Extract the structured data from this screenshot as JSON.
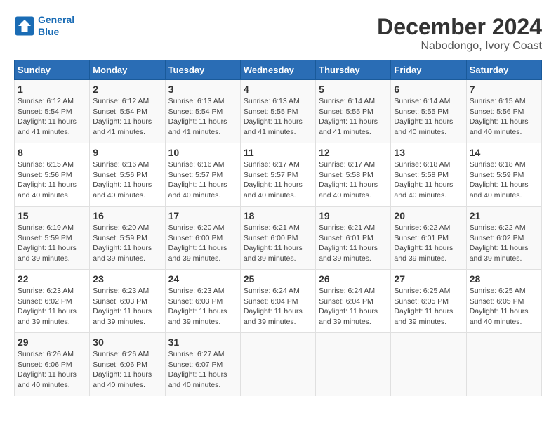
{
  "logo": {
    "line1": "General",
    "line2": "Blue"
  },
  "title": "December 2024",
  "subtitle": "Nabodongo, Ivory Coast",
  "days_of_week": [
    "Sunday",
    "Monday",
    "Tuesday",
    "Wednesday",
    "Thursday",
    "Friday",
    "Saturday"
  ],
  "weeks": [
    [
      {
        "num": "1",
        "sunrise": "6:12 AM",
        "sunset": "5:54 PM",
        "daylight": "11 hours and 41 minutes."
      },
      {
        "num": "2",
        "sunrise": "6:12 AM",
        "sunset": "5:54 PM",
        "daylight": "11 hours and 41 minutes."
      },
      {
        "num": "3",
        "sunrise": "6:13 AM",
        "sunset": "5:54 PM",
        "daylight": "11 hours and 41 minutes."
      },
      {
        "num": "4",
        "sunrise": "6:13 AM",
        "sunset": "5:55 PM",
        "daylight": "11 hours and 41 minutes."
      },
      {
        "num": "5",
        "sunrise": "6:14 AM",
        "sunset": "5:55 PM",
        "daylight": "11 hours and 41 minutes."
      },
      {
        "num": "6",
        "sunrise": "6:14 AM",
        "sunset": "5:55 PM",
        "daylight": "11 hours and 40 minutes."
      },
      {
        "num": "7",
        "sunrise": "6:15 AM",
        "sunset": "5:56 PM",
        "daylight": "11 hours and 40 minutes."
      }
    ],
    [
      {
        "num": "8",
        "sunrise": "6:15 AM",
        "sunset": "5:56 PM",
        "daylight": "11 hours and 40 minutes."
      },
      {
        "num": "9",
        "sunrise": "6:16 AM",
        "sunset": "5:56 PM",
        "daylight": "11 hours and 40 minutes."
      },
      {
        "num": "10",
        "sunrise": "6:16 AM",
        "sunset": "5:57 PM",
        "daylight": "11 hours and 40 minutes."
      },
      {
        "num": "11",
        "sunrise": "6:17 AM",
        "sunset": "5:57 PM",
        "daylight": "11 hours and 40 minutes."
      },
      {
        "num": "12",
        "sunrise": "6:17 AM",
        "sunset": "5:58 PM",
        "daylight": "11 hours and 40 minutes."
      },
      {
        "num": "13",
        "sunrise": "6:18 AM",
        "sunset": "5:58 PM",
        "daylight": "11 hours and 40 minutes."
      },
      {
        "num": "14",
        "sunrise": "6:18 AM",
        "sunset": "5:59 PM",
        "daylight": "11 hours and 40 minutes."
      }
    ],
    [
      {
        "num": "15",
        "sunrise": "6:19 AM",
        "sunset": "5:59 PM",
        "daylight": "11 hours and 39 minutes."
      },
      {
        "num": "16",
        "sunrise": "6:20 AM",
        "sunset": "5:59 PM",
        "daylight": "11 hours and 39 minutes."
      },
      {
        "num": "17",
        "sunrise": "6:20 AM",
        "sunset": "6:00 PM",
        "daylight": "11 hours and 39 minutes."
      },
      {
        "num": "18",
        "sunrise": "6:21 AM",
        "sunset": "6:00 PM",
        "daylight": "11 hours and 39 minutes."
      },
      {
        "num": "19",
        "sunrise": "6:21 AM",
        "sunset": "6:01 PM",
        "daylight": "11 hours and 39 minutes."
      },
      {
        "num": "20",
        "sunrise": "6:22 AM",
        "sunset": "6:01 PM",
        "daylight": "11 hours and 39 minutes."
      },
      {
        "num": "21",
        "sunrise": "6:22 AM",
        "sunset": "6:02 PM",
        "daylight": "11 hours and 39 minutes."
      }
    ],
    [
      {
        "num": "22",
        "sunrise": "6:23 AM",
        "sunset": "6:02 PM",
        "daylight": "11 hours and 39 minutes."
      },
      {
        "num": "23",
        "sunrise": "6:23 AM",
        "sunset": "6:03 PM",
        "daylight": "11 hours and 39 minutes."
      },
      {
        "num": "24",
        "sunrise": "6:23 AM",
        "sunset": "6:03 PM",
        "daylight": "11 hours and 39 minutes."
      },
      {
        "num": "25",
        "sunrise": "6:24 AM",
        "sunset": "6:04 PM",
        "daylight": "11 hours and 39 minutes."
      },
      {
        "num": "26",
        "sunrise": "6:24 AM",
        "sunset": "6:04 PM",
        "daylight": "11 hours and 39 minutes."
      },
      {
        "num": "27",
        "sunrise": "6:25 AM",
        "sunset": "6:05 PM",
        "daylight": "11 hours and 39 minutes."
      },
      {
        "num": "28",
        "sunrise": "6:25 AM",
        "sunset": "6:05 PM",
        "daylight": "11 hours and 40 minutes."
      }
    ],
    [
      {
        "num": "29",
        "sunrise": "6:26 AM",
        "sunset": "6:06 PM",
        "daylight": "11 hours and 40 minutes."
      },
      {
        "num": "30",
        "sunrise": "6:26 AM",
        "sunset": "6:06 PM",
        "daylight": "11 hours and 40 minutes."
      },
      {
        "num": "31",
        "sunrise": "6:27 AM",
        "sunset": "6:07 PM",
        "daylight": "11 hours and 40 minutes."
      },
      null,
      null,
      null,
      null
    ]
  ]
}
